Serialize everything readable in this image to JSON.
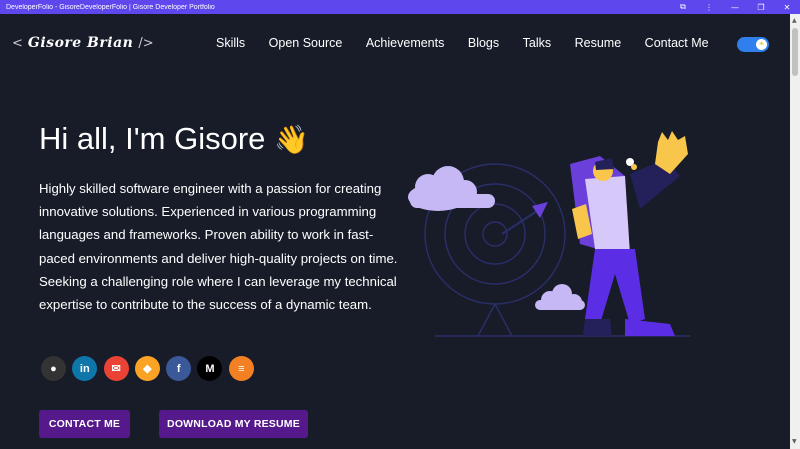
{
  "window": {
    "title": "DeveloperFolio - GisoreDeveloperFolio | Gisore Developer Portfolio",
    "controls": {
      "extensions": "⧉",
      "menu": "⋮",
      "minimize": "—",
      "restore": "❐",
      "close": "✕"
    }
  },
  "header": {
    "logo_open": "<",
    "logo_name": "Gisore Brian",
    "logo_close": "/>",
    "nav": [
      "Skills",
      "Open Source",
      "Achievements",
      "Blogs",
      "Talks",
      "Resume",
      "Contact Me"
    ],
    "theme_toggle_icon": "☀"
  },
  "hero": {
    "greeting": "Hi all, I'm Gisore",
    "wave_emoji": "👋",
    "description": "Highly skilled software engineer with a passion for creating innovative solutions. Experienced in various programming languages and frameworks. Proven ability to work in fast-paced environments and deliver high-quality projects on time. Seeking a challenging role where I can leverage my technical expertise to contribute to the success of a dynamic team.",
    "socials": [
      {
        "name": "github",
        "glyph": "●",
        "color": "#333333"
      },
      {
        "name": "linkedin",
        "glyph": "in",
        "color": "#0e76a8"
      },
      {
        "name": "email",
        "glyph": "✉",
        "color": "#ea4335"
      },
      {
        "name": "gitlab",
        "glyph": "◆",
        "color": "#fca326"
      },
      {
        "name": "facebook",
        "glyph": "f",
        "color": "#3b5998"
      },
      {
        "name": "medium",
        "glyph": "M",
        "color": "#000000"
      },
      {
        "name": "stackoverflow",
        "glyph": "≡",
        "color": "#f48024"
      }
    ],
    "contact_button": "CONTACT ME",
    "resume_button": "DOWNLOAD MY RESUME"
  },
  "colors": {
    "titlebar": "#5f47ee",
    "background": "#171c28",
    "button": "#55198b",
    "toggle": "#2f80ed"
  }
}
